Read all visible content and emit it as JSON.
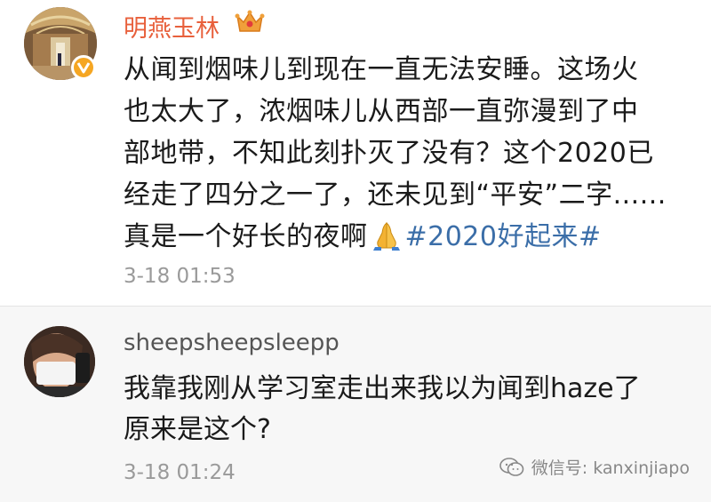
{
  "post": {
    "username": "明燕玉林",
    "text_lines": [
      "从闻到烟味儿到现在一直无法安睡。这场火",
      "也太大了，浓烟味儿从西部一直弥漫到了中",
      "部地带，不知此刻扑灭了没有？这个2020已",
      "经走了四分之一了，还未见到“平安”二字......"
    ],
    "last_line_text": "真是一个好长的夜啊",
    "hashtag": "#2020好起来#",
    "timestamp": "3-18 01:53"
  },
  "comment": {
    "username": "sheepsheepsleepp",
    "text_lines": [
      "我靠我刚从学习室走出来我以为闻到haze了",
      "原来是这个?"
    ],
    "timestamp": "3-18 01:24"
  },
  "watermark": {
    "text": "微信号: kanxinjiapo"
  },
  "colors": {
    "username_orange": "#e8603c",
    "hashtag_blue": "#3b6ea8",
    "timestamp_gray": "#9a9a9a",
    "verified_badge": "#f5a623"
  },
  "icons": [
    "crown-icon",
    "verified-icon",
    "pray-hands-icon",
    "wechat-icon"
  ]
}
